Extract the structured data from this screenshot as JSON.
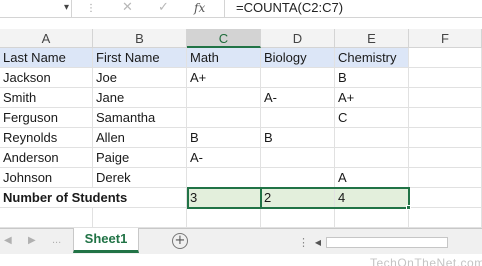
{
  "formula_bar": {
    "name_box_arrow": "▾",
    "separator": "⋮",
    "cancel_glyph": "✕",
    "enter_glyph": "✓",
    "fx_label": "fx",
    "formula": "=COUNTA(C2:C7)"
  },
  "columns": [
    "A",
    "B",
    "C",
    "D",
    "E",
    "F"
  ],
  "selected_column": "C",
  "header_row": [
    "Last Name",
    "First Name",
    "Math",
    "Biology",
    "Chemistry"
  ],
  "rows": [
    [
      "Jackson",
      "Joe",
      "A+",
      "",
      "B"
    ],
    [
      "Smith",
      "Jane",
      "",
      "A-",
      "A+"
    ],
    [
      "Ferguson",
      "Samantha",
      "",
      "",
      "C"
    ],
    [
      "Reynolds",
      "Allen",
      "B",
      "B",
      ""
    ],
    [
      "Anderson",
      "Paige",
      "A-",
      "",
      ""
    ],
    [
      "Johnson",
      "Derek",
      "",
      "",
      "A"
    ]
  ],
  "total_row": [
    "Number of Students",
    "",
    "3",
    "2",
    "4"
  ],
  "sheet_tabs": {
    "active": "Sheet1",
    "prev_arrow": "◀",
    "next_arrow": "▶",
    "dots": "...",
    "add_symbol": "+",
    "split_glyph": "⋮",
    "scroll_left": "◀"
  },
  "watermark": "TechOnTheNet.com",
  "colors": {
    "accent": "#217346",
    "header_fill": "#dce6f7",
    "selection_fill": "#e3efdc"
  }
}
